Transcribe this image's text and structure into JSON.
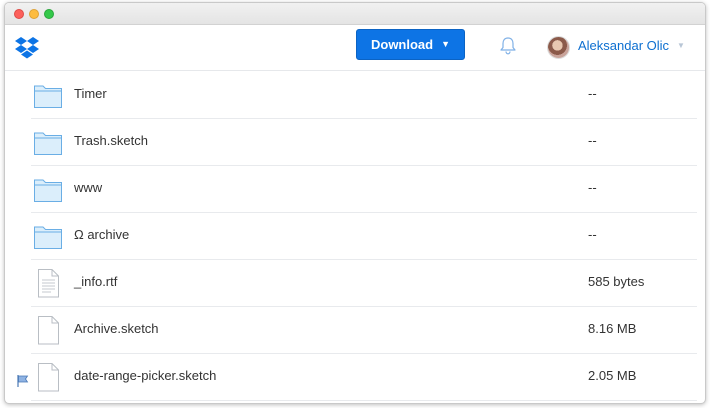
{
  "header": {
    "download_label": "Download",
    "download_caret": "▼",
    "user_name": "Aleksandar Olic",
    "user_caret": "▼"
  },
  "files": [
    {
      "name": "Timer",
      "size": "--",
      "icon": "folder-icon"
    },
    {
      "name": "Trash.sketch",
      "size": "--",
      "icon": "folder-icon"
    },
    {
      "name": "www",
      "size": "--",
      "icon": "folder-icon"
    },
    {
      "name": "Ω archive",
      "size": "--",
      "icon": "folder-icon"
    },
    {
      "name": "_info.rtf",
      "size": "585 bytes",
      "icon": "text-file-icon"
    },
    {
      "name": "Archive.sketch",
      "size": "8.16 MB",
      "icon": "file-icon"
    },
    {
      "name": "date-range-picker.sketch",
      "size": "2.05 MB",
      "icon": "file-icon"
    }
  ],
  "colors": {
    "accent": "#0d74e5",
    "link": "#0d6fd0",
    "folder_fill": "#dbeefb",
    "folder_stroke": "#6aaee5"
  }
}
